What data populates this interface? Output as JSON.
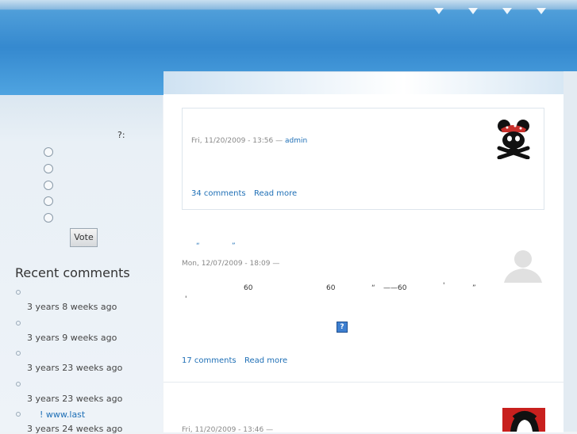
{
  "poll": {
    "question_suffix": "?:",
    "option_count": 5,
    "vote_label": "Vote"
  },
  "recent_comments": {
    "title": "Recent comments",
    "items": [
      {
        "link": "",
        "time": "3 years 8 weeks ago"
      },
      {
        "link": "",
        "time": "3 years 9 weeks ago"
      },
      {
        "link": "",
        "time": "3 years 23 weeks ago"
      },
      {
        "link": "",
        "time": "3 years 23 weeks ago"
      },
      {
        "link": "! www.last",
        "time": "3 years 24 weeks ago"
      }
    ]
  },
  "posts": [
    {
      "meta": "Fri, 11/20/2009 - 13:56 —",
      "author": "admin",
      "comments": "34 comments",
      "read_more": "Read more",
      "avatar": "pirate-mouse-avatar"
    },
    {
      "title_left": "“",
      "title_right": "”",
      "meta": "Mon, 12/07/2009 - 18:09 —",
      "body": [
        "60",
        "60",
        "“",
        "——60",
        "'",
        "”",
        "'"
      ],
      "comments": "17 comments",
      "read_more": "Read more",
      "avatar": "default-user-avatar"
    },
    {
      "meta": "Fri, 11/20/2009 - 13:46 —",
      "avatar": "che-avatar"
    }
  ],
  "icons": {
    "help": "?"
  }
}
